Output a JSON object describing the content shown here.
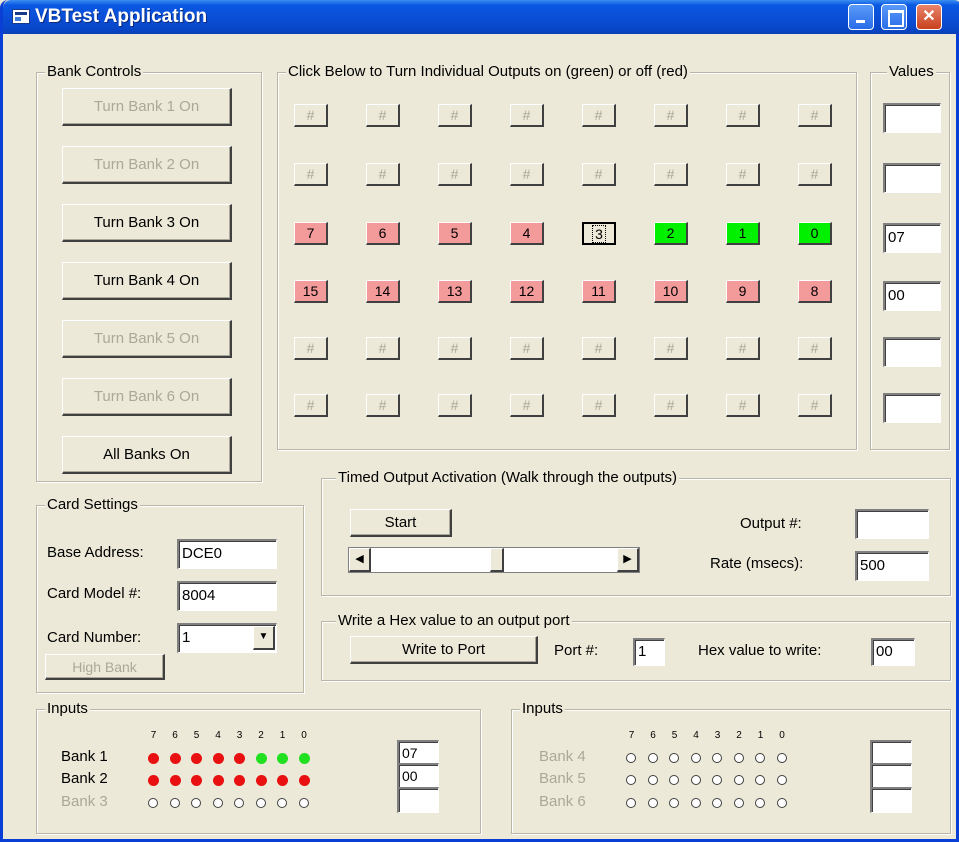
{
  "window": {
    "title": "VBTest Application",
    "minimize_glyph": "",
    "maximize_glyph": "",
    "close_glyph": "✕"
  },
  "bank_controls": {
    "label": "Bank Controls",
    "buttons": [
      {
        "label": "Turn Bank 1 On",
        "enabled": false
      },
      {
        "label": "Turn Bank 2 On",
        "enabled": false
      },
      {
        "label": "Turn Bank 3 On",
        "enabled": true
      },
      {
        "label": "Turn Bank 4 On",
        "enabled": true
      },
      {
        "label": "Turn Bank 5 On",
        "enabled": false
      },
      {
        "label": "Turn Bank 6 On",
        "enabled": false
      },
      {
        "label": "All Banks On",
        "enabled": true
      }
    ]
  },
  "outputs": {
    "label": "Click Below to Turn Individual Outputs on (green) or off (red)",
    "rows": [
      [
        {
          "text": "#",
          "state": "disabled"
        },
        {
          "text": "#",
          "state": "disabled"
        },
        {
          "text": "#",
          "state": "disabled"
        },
        {
          "text": "#",
          "state": "disabled"
        },
        {
          "text": "#",
          "state": "disabled"
        },
        {
          "text": "#",
          "state": "disabled"
        },
        {
          "text": "#",
          "state": "disabled"
        },
        {
          "text": "#",
          "state": "disabled"
        }
      ],
      [
        {
          "text": "#",
          "state": "disabled"
        },
        {
          "text": "#",
          "state": "disabled"
        },
        {
          "text": "#",
          "state": "disabled"
        },
        {
          "text": "#",
          "state": "disabled"
        },
        {
          "text": "#",
          "state": "disabled"
        },
        {
          "text": "#",
          "state": "disabled"
        },
        {
          "text": "#",
          "state": "disabled"
        },
        {
          "text": "#",
          "state": "disabled"
        }
      ],
      [
        {
          "text": "7",
          "state": "red"
        },
        {
          "text": "6",
          "state": "red"
        },
        {
          "text": "5",
          "state": "red"
        },
        {
          "text": "4",
          "state": "red"
        },
        {
          "text": "3",
          "state": "focused"
        },
        {
          "text": "2",
          "state": "green"
        },
        {
          "text": "1",
          "state": "green"
        },
        {
          "text": "0",
          "state": "green"
        }
      ],
      [
        {
          "text": "15",
          "state": "red"
        },
        {
          "text": "14",
          "state": "red"
        },
        {
          "text": "13",
          "state": "red"
        },
        {
          "text": "12",
          "state": "red"
        },
        {
          "text": "11",
          "state": "red"
        },
        {
          "text": "10",
          "state": "red"
        },
        {
          "text": "9",
          "state": "red"
        },
        {
          "text": "8",
          "state": "red"
        }
      ],
      [
        {
          "text": "#",
          "state": "disabled"
        },
        {
          "text": "#",
          "state": "disabled"
        },
        {
          "text": "#",
          "state": "disabled"
        },
        {
          "text": "#",
          "state": "disabled"
        },
        {
          "text": "#",
          "state": "disabled"
        },
        {
          "text": "#",
          "state": "disabled"
        },
        {
          "text": "#",
          "state": "disabled"
        },
        {
          "text": "#",
          "state": "disabled"
        }
      ],
      [
        {
          "text": "#",
          "state": "disabled"
        },
        {
          "text": "#",
          "state": "disabled"
        },
        {
          "text": "#",
          "state": "disabled"
        },
        {
          "text": "#",
          "state": "disabled"
        },
        {
          "text": "#",
          "state": "disabled"
        },
        {
          "text": "#",
          "state": "disabled"
        },
        {
          "text": "#",
          "state": "disabled"
        },
        {
          "text": "#",
          "state": "disabled"
        }
      ]
    ]
  },
  "values": {
    "label": "Values",
    "items": [
      "",
      "",
      "07",
      "00",
      "",
      ""
    ]
  },
  "card_settings": {
    "label": "Card Settings",
    "base_address_label": "Base Address:",
    "base_address": "DCE0",
    "card_model_label": "Card Model #:",
    "card_model": "8004",
    "card_number_label": "Card Number:",
    "card_number": "1",
    "high_bank_label": "High Bank"
  },
  "timed": {
    "label": "Timed Output Activation  (Walk through the outputs)",
    "start_label": "Start",
    "output_label": "Output #:",
    "output_value": "",
    "rate_label": "Rate (msecs):",
    "rate_value": "500",
    "scroll_left": "◀",
    "scroll_right": "▶"
  },
  "hexwrite": {
    "label": "Write a Hex value to an output port",
    "button_label": "Write to Port",
    "port_label": "Port #:",
    "port_value": "1",
    "hex_label": "Hex value to write:",
    "hex_value": "00"
  },
  "inputs_left": {
    "label": "Inputs",
    "bits": [
      "7",
      "6",
      "5",
      "4",
      "3",
      "2",
      "1",
      "0"
    ],
    "banks": [
      {
        "name": "Bank 1",
        "enabled": true,
        "value": "07",
        "leds": [
          "red",
          "red",
          "red",
          "red",
          "red",
          "green",
          "green",
          "green"
        ]
      },
      {
        "name": "Bank 2",
        "enabled": true,
        "value": "00",
        "leds": [
          "red",
          "red",
          "red",
          "red",
          "red",
          "red",
          "red",
          "red"
        ]
      },
      {
        "name": "Bank 3",
        "enabled": false,
        "value": "",
        "leds": [
          "off",
          "off",
          "off",
          "off",
          "off",
          "off",
          "off",
          "off"
        ]
      }
    ]
  },
  "inputs_right": {
    "label": "Inputs",
    "bits": [
      "7",
      "6",
      "5",
      "4",
      "3",
      "2",
      "1",
      "0"
    ],
    "banks": [
      {
        "name": "Bank 4",
        "enabled": false,
        "value": "",
        "leds": [
          "off",
          "off",
          "off",
          "off",
          "off",
          "off",
          "off",
          "off"
        ]
      },
      {
        "name": "Bank 5",
        "enabled": false,
        "value": "",
        "leds": [
          "off",
          "off",
          "off",
          "off",
          "off",
          "off",
          "off",
          "off"
        ]
      },
      {
        "name": "Bank 6",
        "enabled": false,
        "value": "",
        "leds": [
          "off",
          "off",
          "off",
          "off",
          "off",
          "off",
          "off",
          "off"
        ]
      }
    ]
  }
}
